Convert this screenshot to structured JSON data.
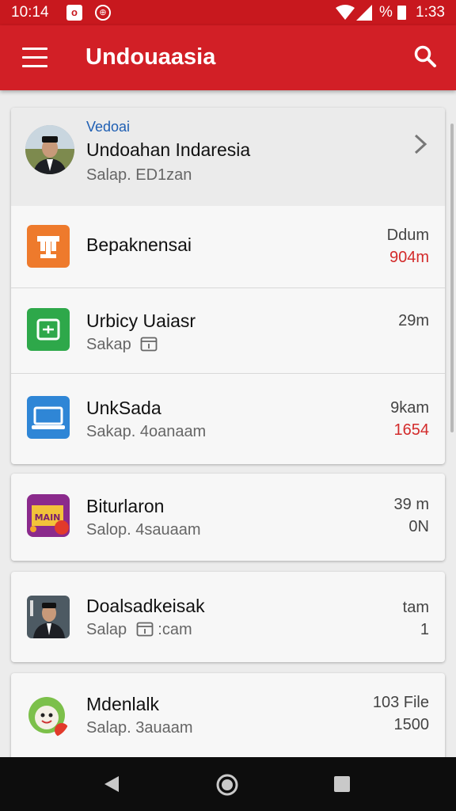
{
  "status_bar": {
    "time": "10:14",
    "battery_text": "%",
    "clock": "1:33"
  },
  "app_bar": {
    "title": "Undouaasia"
  },
  "featured": {
    "label": "Vedoai",
    "title": "Undoahan Indaresia",
    "subtitle": "Salap. ED1zan"
  },
  "items": [
    {
      "title": "Bepaknensai",
      "subtitle": "",
      "meta1": "Ddum",
      "meta2": "904m",
      "icon": "trophy-icon",
      "color": "#ee7a2c"
    },
    {
      "title": "Urbicy Uaiasr",
      "subtitle": "Sakap",
      "meta1": "29m",
      "meta2": "",
      "icon": "calendar-icon",
      "color": "#2ea84a"
    },
    {
      "title": "UnkSada",
      "subtitle": "Sakap. 4oanaam",
      "meta1": "9kam",
      "meta2": "1654",
      "icon": "laptop-icon",
      "color": "#2f86d6"
    },
    {
      "title": "Biturlaron",
      "subtitle": "Salop. 4sauaam",
      "meta1": "39 m",
      "meta2": "0N",
      "icon": "festival-poster-icon",
      "color": "#8b2a8c"
    },
    {
      "title": "Doalsadkeisak",
      "subtitle": "Salap",
      "subtitle_extra": ":cam",
      "meta1": "tam",
      "meta2": "1",
      "icon": "person-portrait-icon",
      "color": "#4d5a63"
    },
    {
      "title": "Mdenlalk",
      "subtitle": "Salap. 3auaam",
      "meta1": "103 File",
      "meta2": "1500",
      "icon": "mascot-icon",
      "color": "#7cc04a"
    }
  ],
  "colors": {
    "primary": "#d21f26",
    "status_bar": "#c8181e",
    "accent_red": "#d32b2b",
    "link_blue": "#1f5fb3"
  }
}
